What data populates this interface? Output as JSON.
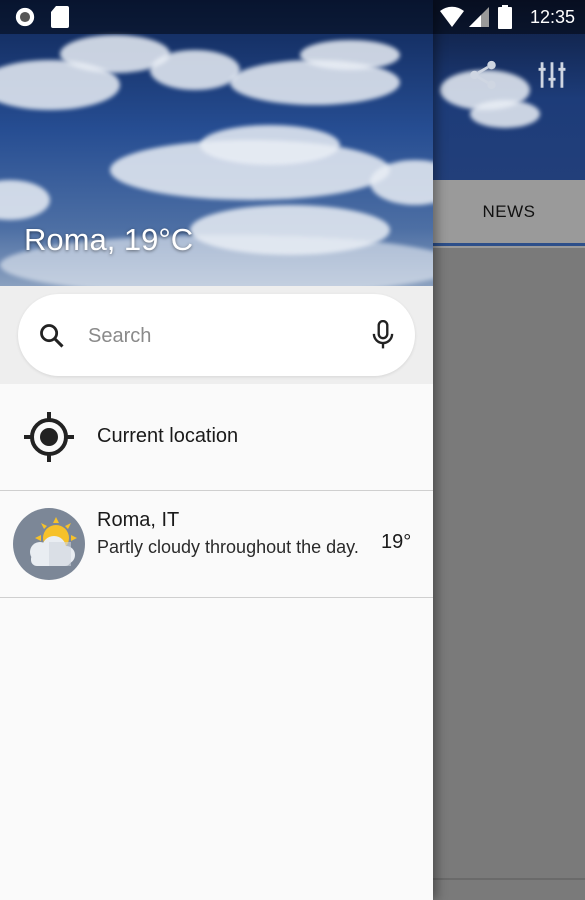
{
  "status_bar": {
    "time": "12:35"
  },
  "background_app": {
    "tabs": [
      {
        "label": "NEWS"
      }
    ]
  },
  "drawer": {
    "header_title": "Roma, 19°C",
    "search": {
      "placeholder": "Search"
    },
    "current_location_label": "Current location",
    "locations": [
      {
        "name": "Roma, IT",
        "description": "Partly cloudy throughout the day.",
        "temperature": "19°",
        "icon": "partly-cloudy-icon"
      }
    ]
  },
  "colors": {
    "accent": "#2d4f8a",
    "drawer_bg": "#fafafa",
    "scrim": "#7a7a7a"
  }
}
